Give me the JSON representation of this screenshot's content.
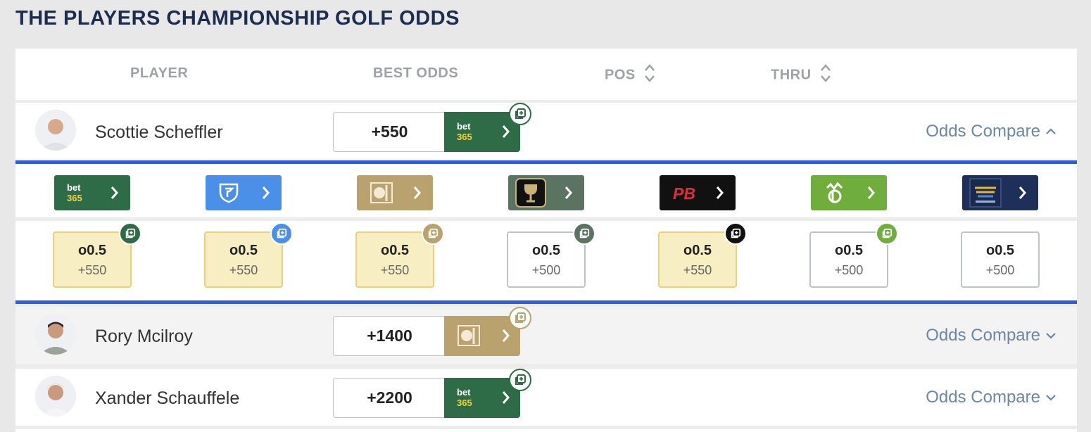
{
  "page_title": "THE PLAYERS CHAMPIONSHIP GOLF ODDS",
  "columns": {
    "player": "PLAYER",
    "best_odds": "BEST ODDS",
    "pos": "POS",
    "thru": "THRU"
  },
  "players": [
    {
      "name": "Scottie Scheffler",
      "best_odds": "+550",
      "book": "bet365",
      "compare_label": "Odds Compare",
      "expanded": true
    },
    {
      "name": "Rory Mcilroy",
      "best_odds": "+1400",
      "book": "BetMGM",
      "compare_label": "Odds Compare",
      "expanded": false
    },
    {
      "name": "Xander Schauffele",
      "best_odds": "+2200",
      "book": "bet365",
      "compare_label": "Odds Compare",
      "expanded": false
    }
  ],
  "sportsbooks": [
    {
      "name": "bet365",
      "color": "#2e6b47",
      "badge": "#2e6b47",
      "line": "o0.5",
      "price": "+550",
      "best": true
    },
    {
      "name": "FanDuel",
      "color": "#4a90e8",
      "badge": "#4a90e8",
      "line": "o0.5",
      "price": "+550",
      "best": true
    },
    {
      "name": "BetMGM",
      "color": "#b9a26d",
      "badge": "#b9a26d",
      "line": "o0.5",
      "price": "+550",
      "best": true
    },
    {
      "name": "Caesars",
      "color": "#5b7462",
      "badge": "#5b7462",
      "line": "o0.5",
      "price": "+500",
      "best": false
    },
    {
      "name": "PointsBet",
      "color": "#111111",
      "badge": "#111111",
      "line": "o0.5",
      "price": "+550",
      "best": true
    },
    {
      "name": "DraftKings",
      "color": "#6fae3c",
      "badge": "#6fae3c",
      "line": "o0.5",
      "price": "+500",
      "best": false
    },
    {
      "name": "BetRivers",
      "color": "#1e2f59",
      "badge": "#1e2f59",
      "line": "o0.5",
      "price": "+500",
      "best": false
    }
  ],
  "logos": {
    "bet365": "bet\n365",
    "pointsbet": "PB"
  },
  "colors": {
    "title": "#1c2d52",
    "expanded_border": "#2f5fe0",
    "link": "#6c86a5",
    "best_bg": "#f7eec3"
  }
}
